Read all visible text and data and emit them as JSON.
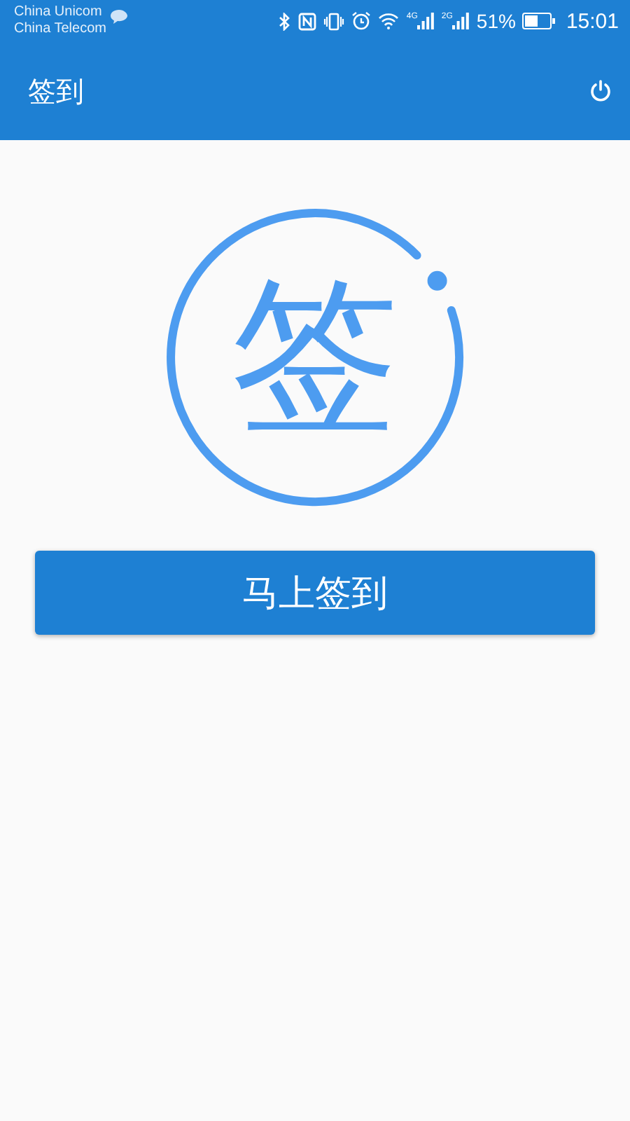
{
  "status_bar": {
    "carriers": [
      "China Unicom",
      "China Telecom"
    ],
    "network_labels": [
      "4G",
      "2G"
    ],
    "battery": "51%",
    "time": "15:01"
  },
  "app_bar": {
    "title": "签到"
  },
  "logo": {
    "character": "签"
  },
  "sign_in_button": {
    "label": "马上签到"
  }
}
